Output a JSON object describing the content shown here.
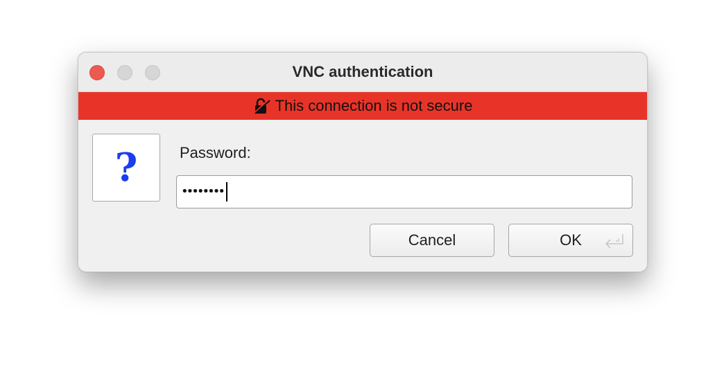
{
  "window": {
    "title": "VNC authentication",
    "controls": [
      "close",
      "minimize",
      "maximize"
    ]
  },
  "banner": {
    "text": "This connection is not secure",
    "icon": "unlocked-lock-icon",
    "color": "#e83428"
  },
  "dialog": {
    "question_icon_text": "?",
    "password_label": "Password:",
    "password_value": "••••••••"
  },
  "buttons": {
    "cancel_label": "Cancel",
    "ok_label": "OK"
  }
}
